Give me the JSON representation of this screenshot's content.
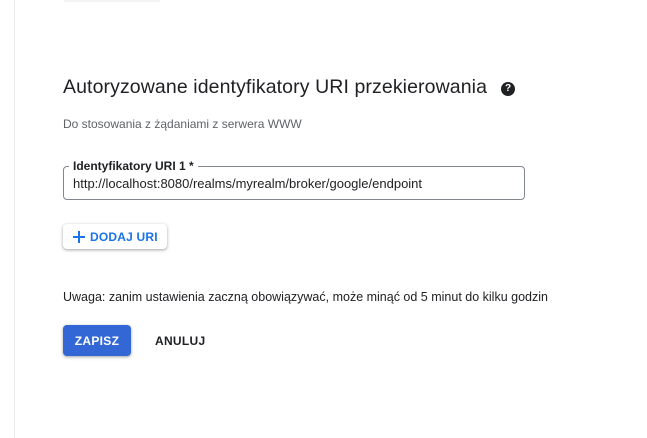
{
  "section": {
    "title": "Autoryzowane identyfikatory URI przekierowania",
    "help_icon": "question-mark-circle-icon",
    "subtitle": "Do stosowania z żądaniami z serwera WWW"
  },
  "uri_field": {
    "label": "Identyfikatory URI 1 *",
    "value": "http://localhost:8080/realms/myrealm/broker/google/endpoint"
  },
  "add_uri_button": {
    "icon": "plus-icon",
    "label": "DODAJ URI"
  },
  "note": "Uwaga: zanim ustawienia zaczną obowiązywać, może minąć od 5 minut do kilku godzin",
  "actions": {
    "save_label": "ZAPISZ",
    "cancel_label": "ANULUJ"
  },
  "colors": {
    "primary": "#3367d6",
    "accent_text": "#1a73e8",
    "text": "#202124",
    "muted_text": "#5f6368"
  }
}
